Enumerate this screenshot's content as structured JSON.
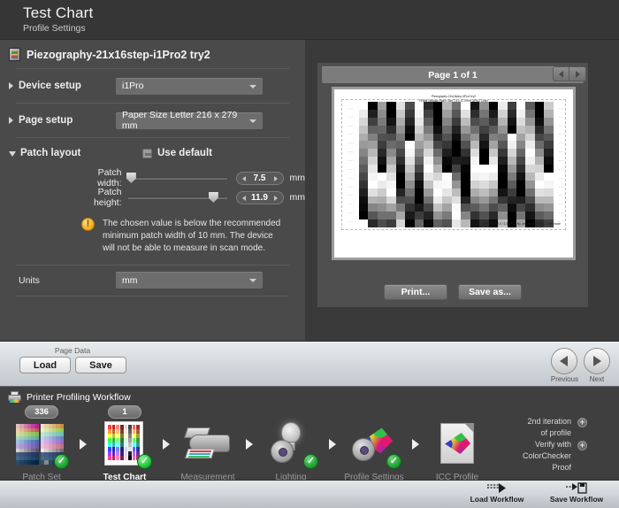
{
  "window": {
    "title": "Test Chart",
    "subtitle": "Profile Settings"
  },
  "document": {
    "name": "Piezography-21x16step-i1Pro2 try2",
    "icon": "document-thumbnail-icon"
  },
  "settings": {
    "device_setup": {
      "label": "Device setup",
      "value": "i1Pro",
      "expanded": false
    },
    "page_setup": {
      "label": "Page setup",
      "value": "Paper Size Letter  216 x 279 mm",
      "expanded": false
    },
    "patch_layout": {
      "label": "Patch layout",
      "expanded": true,
      "use_default_label": "Use default",
      "use_default_checked": false,
      "patch_width": {
        "label": "Patch width:",
        "value": "7.5",
        "unit": "mm",
        "slider_pct": 3
      },
      "patch_height": {
        "label": "Patch height:",
        "value": "11.9",
        "unit": "mm",
        "slider_pct": 86
      },
      "warning": "The chosen value is below the recommended minimum patch width of 10 mm. The device will not be able to measure in scan mode.",
      "warning_icon": "warning-icon"
    },
    "units": {
      "label": "Units",
      "value": "mm"
    }
  },
  "preview": {
    "page_indicator": "Page 1 of 1",
    "prev_icon": "chevron-left-icon",
    "next_icon": "chevron-right-icon",
    "chart_title_line1": "Piezography-21x16step-i1Pro2 try2",
    "chart_title_line2": "Profile Settings  Patch Size  7.5 x 11.9 mm  i1Pro2  Chart",
    "chart_footer": "i1Profiler  8.7.0 / 3.3.1™  ID No. Instrument i1 Pro 2 scan mode",
    "print_button": "Print...",
    "save_as_button": "Save as..."
  },
  "page_data": {
    "group_label": "Page Data",
    "load_button": "Load",
    "save_button": "Save"
  },
  "wizard_nav": {
    "previous_label": "Previous",
    "next_label": "Next",
    "previous_icon": "arrow-left-circle-icon",
    "next_icon": "arrow-right-circle-icon"
  },
  "workflow": {
    "header": "Printer Profiling Workflow",
    "header_icon": "printer-icon",
    "steps": [
      {
        "label": "Patch Set",
        "badge": "336",
        "icon": "patch-set-grid-icon",
        "complete": true,
        "active": false
      },
      {
        "label": "Test Chart",
        "badge": "1",
        "icon": "test-chart-icon",
        "complete": true,
        "active": true
      },
      {
        "label": "Measurement",
        "badge": "",
        "icon": "printer-measure-icon",
        "complete": false,
        "active": false
      },
      {
        "label": "Lighting",
        "badge": "",
        "icon": "lightbulb-gear-icon",
        "complete": true,
        "active": false
      },
      {
        "label": "Profile Settings",
        "badge": "",
        "icon": "gamut-gear-icon",
        "complete": true,
        "active": false
      },
      {
        "label": "ICC Profile",
        "badge": "",
        "icon": "icc-profile-document-icon",
        "complete": false,
        "active": false
      }
    ],
    "iteration": {
      "line1": "2nd iteration",
      "line2": "of profile",
      "line3": "Verify with",
      "line4": "ColorChecker",
      "line5": "Proof",
      "plus1": "+",
      "plus2": "+"
    }
  },
  "statusbar": {
    "load_workflow": "Load Workflow",
    "save_workflow": "Save Workflow",
    "load_workflow_icon": "load-workflow-icon",
    "save_workflow_icon": "save-workflow-icon"
  },
  "colors": {
    "window_bg": "#3a3a3a",
    "titlebar_bg": "#363636",
    "leftpane_bg": "#4a4a4a",
    "rightpane_bg": "#4f4f4f",
    "accent_green": "#14bf2e",
    "accent_amber": "#f0a81e"
  },
  "chart_data": {
    "type": "heatmap",
    "title": "Piezography-21x16step-i1Pro2 try2",
    "description": "Grayscale step-wedge test chart preview: 21 vertical strips of 16 gray steps each",
    "strip_count": 21,
    "steps_per_strip": 16,
    "gutter_marks": "....",
    "strips": [
      [
        100,
        92,
        84,
        76,
        68,
        60,
        52,
        44,
        36,
        28,
        20,
        12,
        6,
        3,
        0,
        100
      ],
      [
        0,
        12,
        25,
        38,
        50,
        62,
        72,
        82,
        90,
        96,
        100,
        88,
        70,
        52,
        34,
        16
      ],
      [
        62,
        55,
        48,
        40,
        32,
        24,
        16,
        8,
        0,
        100,
        92,
        80,
        68,
        56,
        44,
        30
      ],
      [
        0,
        0,
        8,
        18,
        30,
        42,
        54,
        66,
        78,
        88,
        96,
        100,
        84,
        64,
        44,
        24
      ],
      [
        88,
        78,
        68,
        58,
        48,
        38,
        28,
        18,
        8,
        0,
        0,
        14,
        30,
        48,
        66,
        84
      ],
      [
        30,
        22,
        14,
        6,
        0,
        100,
        96,
        88,
        78,
        68,
        56,
        44,
        32,
        20,
        10,
        2
      ],
      [
        100,
        96,
        90,
        82,
        72,
        62,
        52,
        40,
        28,
        16,
        6,
        0,
        0,
        10,
        24,
        40
      ],
      [
        16,
        26,
        36,
        48,
        60,
        72,
        84,
        94,
        100,
        90,
        76,
        60,
        44,
        28,
        14,
        4
      ],
      [
        0,
        0,
        0,
        6,
        16,
        28,
        42,
        56,
        70,
        84,
        96,
        100,
        92,
        76,
        58,
        38
      ],
      [
        72,
        62,
        52,
        42,
        32,
        22,
        12,
        4,
        0,
        100,
        98,
        90,
        78,
        64,
        48,
        32
      ],
      [
        44,
        34,
        24,
        14,
        6,
        0,
        0,
        12,
        26,
        42,
        58,
        74,
        88,
        98,
        100,
        90
      ],
      [
        100,
        88,
        74,
        60,
        46,
        32,
        20,
        10,
        2,
        0,
        0,
        0,
        14,
        32,
        52,
        72
      ],
      [
        8,
        18,
        30,
        44,
        58,
        72,
        86,
        96,
        100,
        94,
        82,
        68,
        52,
        36,
        20,
        8
      ],
      [
        56,
        46,
        36,
        26,
        16,
        8,
        0,
        0,
        100,
        96,
        86,
        74,
        60,
        46,
        32,
        18
      ],
      [
        0,
        10,
        22,
        36,
        50,
        64,
        78,
        90,
        100,
        92,
        78,
        62,
        46,
        30,
        16,
        4
      ],
      [
        92,
        82,
        70,
        58,
        46,
        34,
        22,
        12,
        4,
        0,
        0,
        8,
        22,
        38,
        56,
        74
      ],
      [
        24,
        16,
        8,
        0,
        100,
        94,
        84,
        72,
        60,
        48,
        36,
        24,
        14,
        6,
        0,
        0
      ],
      [
        100,
        94,
        86,
        76,
        64,
        52,
        40,
        28,
        18,
        8,
        0,
        0,
        12,
        28,
        46,
        64
      ],
      [
        36,
        46,
        58,
        70,
        82,
        92,
        100,
        94,
        84,
        72,
        58,
        44,
        30,
        18,
        8,
        0
      ],
      [
        0,
        0,
        6,
        16,
        28,
        42,
        56,
        70,
        82,
        92,
        100,
        88,
        72,
        54,
        36,
        18
      ],
      [
        80,
        70,
        58,
        46,
        34,
        24,
        14,
        6,
        0,
        100,
        96,
        86,
        72,
        58,
        42,
        26
      ]
    ]
  },
  "patch_set_icon_data": {
    "left_grid": [
      "#e0c0c0",
      "#d8a0b0",
      "#d080a8",
      "#c860a0",
      "#c04098",
      "#b82090",
      "#e8d0a8",
      "#e0b898",
      "#d8a088",
      "#d08878",
      "#c87068",
      "#c05858",
      "#d8e0a0",
      "#c8d890",
      "#b8d080",
      "#a8c870",
      "#98c060",
      "#88b850",
      "#a8d8c0",
      "#98d0b8",
      "#88c8b0",
      "#78c0a8",
      "#68b8a0",
      "#58b098",
      "#a0c0e0",
      "#90b0d8",
      "#8098d0",
      "#7088c8",
      "#6078c0",
      "#5068b8",
      "#c0a8d8",
      "#b098d0",
      "#a088c8",
      "#9078c0",
      "#8068b8",
      "#7058b0",
      "#d0d0d0",
      "#b8b8b8",
      "#a0a0a0",
      "#888888",
      "#707070",
      "#585858",
      "#4a5a80",
      "#42527a",
      "#3a4a72",
      "#32426a",
      "#2a3a62",
      "#22325a",
      "#3a6a8a",
      "#326282",
      "#2a5a7a",
      "#225272",
      "#1a4a6a",
      "#124262",
      "#2a4a6a",
      "#224262",
      "#1a3a5a",
      "#123252",
      "#0a2a4a",
      "#022242"
    ],
    "right_grid": [
      "#f0e0c0",
      "#e8d0a8",
      "#e0c090",
      "#d8b078",
      "#d0a060",
      "#c89048",
      "#e8f0c0",
      "#d8e8a8",
      "#c8e090",
      "#b8d878",
      "#a8d060",
      "#98c848",
      "#c0e8d0",
      "#b0e0c8",
      "#a0d8c0",
      "#90d0b8",
      "#80c8b0",
      "#70c0a8",
      "#c0d0f0",
      "#b0c0e8",
      "#a0b0e0",
      "#90a0d8",
      "#8090d0",
      "#7080c8",
      "#e0c0f0",
      "#d0b0e8",
      "#c0a0e0",
      "#b090d8",
      "#a080d0",
      "#9070c8",
      "#f0c0d8",
      "#e8b0c8",
      "#e0a0b8",
      "#d890a8",
      "#d08098",
      "#c87088",
      "#e8e8e8",
      "#d0d0d0",
      "#b8b8b8",
      "#a0a0a0",
      "#888888",
      "#707070",
      "#50608a",
      "#485882",
      "#40507a",
      "#384872",
      "#30406a",
      "#283862",
      "#40708a",
      "#386882",
      "#30607a",
      "#285872",
      "#20506a",
      "#184862",
      "#305070",
      "px",
      "#284868",
      "#203860",
      "#183058",
      "#102850"
    ]
  },
  "test_chart_icon_strips": [
    [
      "#ff4040",
      "#ffa040",
      "#ffff40",
      "#40ff40",
      "#40ffff",
      "#4040ff",
      "#a040ff",
      "#ff40a0"
    ],
    [
      "#c02020",
      "#c06020",
      "#c0c020",
      "#20c020",
      "#20c0c0",
      "#2020c0",
      "#6020c0",
      "#c02060"
    ],
    [
      "#ff8080",
      "#ffc080",
      "#ffff80",
      "#80ff80",
      "#80ffff",
      "#8080ff",
      "#c080ff",
      "#ff80c0"
    ],
    [
      "#802020",
      "#804020",
      "#808020",
      "#208020",
      "#208080",
      "#202080",
      "#402080",
      "#802040"
    ],
    [
      "#ffd0d0",
      "#ffe8d0",
      "#ffffd0",
      "#d0ffd0",
      "#d0ffff",
      "#d0d0ff",
      "#e8d0ff",
      "#ffd0e8"
    ],
    [
      "#404040",
      "#606060",
      "#808080",
      "#a0a0a0",
      "#c0c0c0",
      "#e0e0e0",
      "#202020",
      "#000000"
    ],
    [
      "#ff6060",
      "#ffb060",
      "#ffff60",
      "#60ff60",
      "#60ffff",
      "#6060ff",
      "#b060ff",
      "#ff60b0"
    ],
    [
      "#a03030",
      "#a06030",
      "#a0a030",
      "#30a030",
      "#30a0a0",
      "#3030a0",
      "#6030a0",
      "#a03060"
    ]
  ]
}
